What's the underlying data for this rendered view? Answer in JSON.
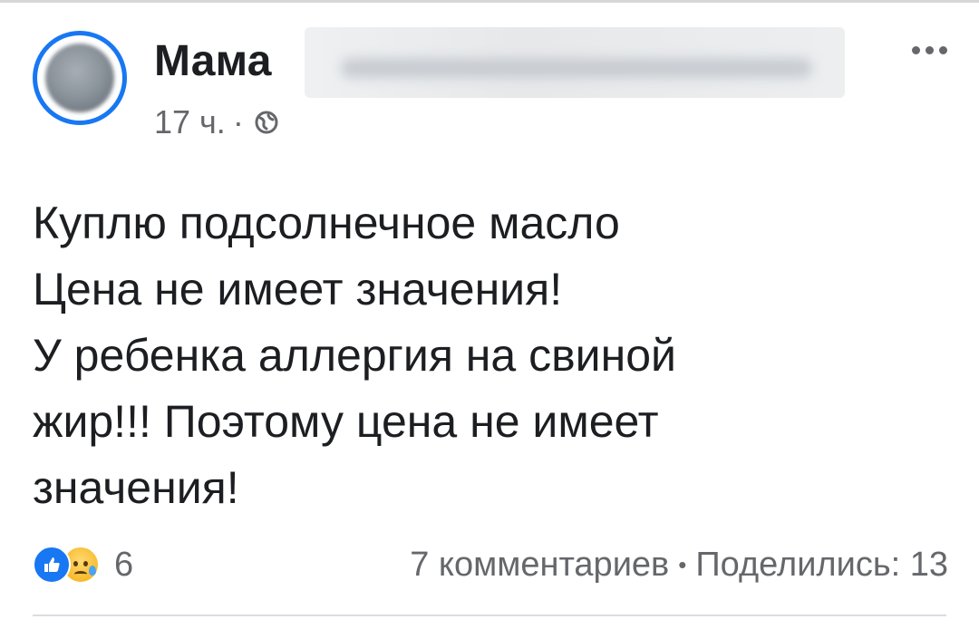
{
  "post": {
    "author_first_name": "Мама",
    "time": "17 ч.",
    "separator": "·",
    "visibility_icon": "globe-icon",
    "text_lines": [
      "Куплю подсолнечное масло",
      "Цена не имеет значения!",
      "У ребенка аллергия на свиной",
      "жир!!! Поэтому цена не имеет",
      "значения!"
    ]
  },
  "reactions": {
    "icons": [
      "like-icon",
      "sad-icon"
    ],
    "count": "6"
  },
  "engagement": {
    "comments": "7 комментариев",
    "bullet": "•",
    "shares": "Поделились: 13"
  },
  "colors": {
    "accent": "#1877f2",
    "text": "#1c1e21",
    "secondary": "#65676b"
  }
}
